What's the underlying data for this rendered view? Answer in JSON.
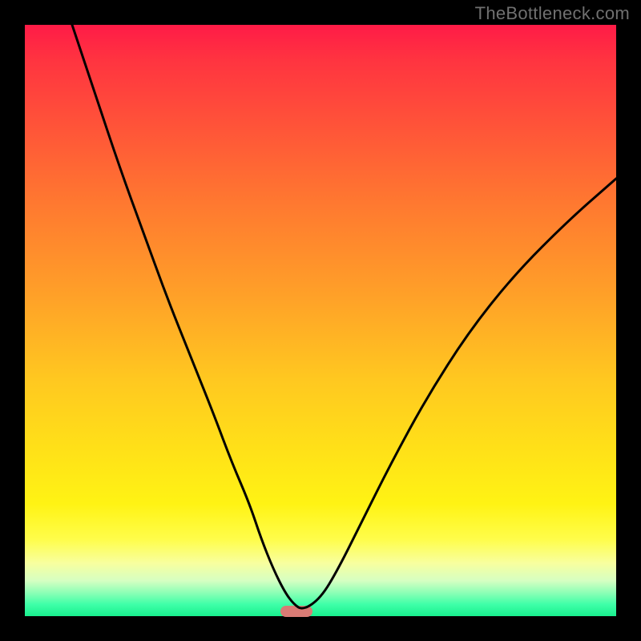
{
  "watermark": "TheBottleneck.com",
  "chart_data": {
    "type": "line",
    "title": "",
    "xlabel": "",
    "ylabel": "",
    "xlim": [
      0,
      100
    ],
    "ylim": [
      0,
      100
    ],
    "series": [
      {
        "name": "curve",
        "x": [
          8,
          12,
          16,
          20,
          24,
          28,
          32,
          35,
          38,
          40,
          42,
          44,
          45.5,
          47,
          50,
          53,
          57,
          62,
          68,
          75,
          83,
          92,
          100
        ],
        "values": [
          100,
          88,
          76,
          65,
          54,
          44,
          34,
          26,
          19,
          13,
          8,
          4,
          2,
          1,
          3,
          8,
          16,
          26,
          37,
          48,
          58,
          67,
          74
        ]
      }
    ],
    "annotations": [
      {
        "kind": "marker",
        "x": 46,
        "y": 0.8,
        "color": "#d97b75"
      }
    ],
    "gradient_stops": [
      {
        "pos": 0,
        "color": "#ff1b47"
      },
      {
        "pos": 50,
        "color": "#ffb424"
      },
      {
        "pos": 80,
        "color": "#fff314"
      },
      {
        "pos": 100,
        "color": "#18f08e"
      }
    ]
  },
  "layout": {
    "plot_left": 31,
    "plot_top": 31,
    "plot_size": 738,
    "frame_size": 800
  }
}
